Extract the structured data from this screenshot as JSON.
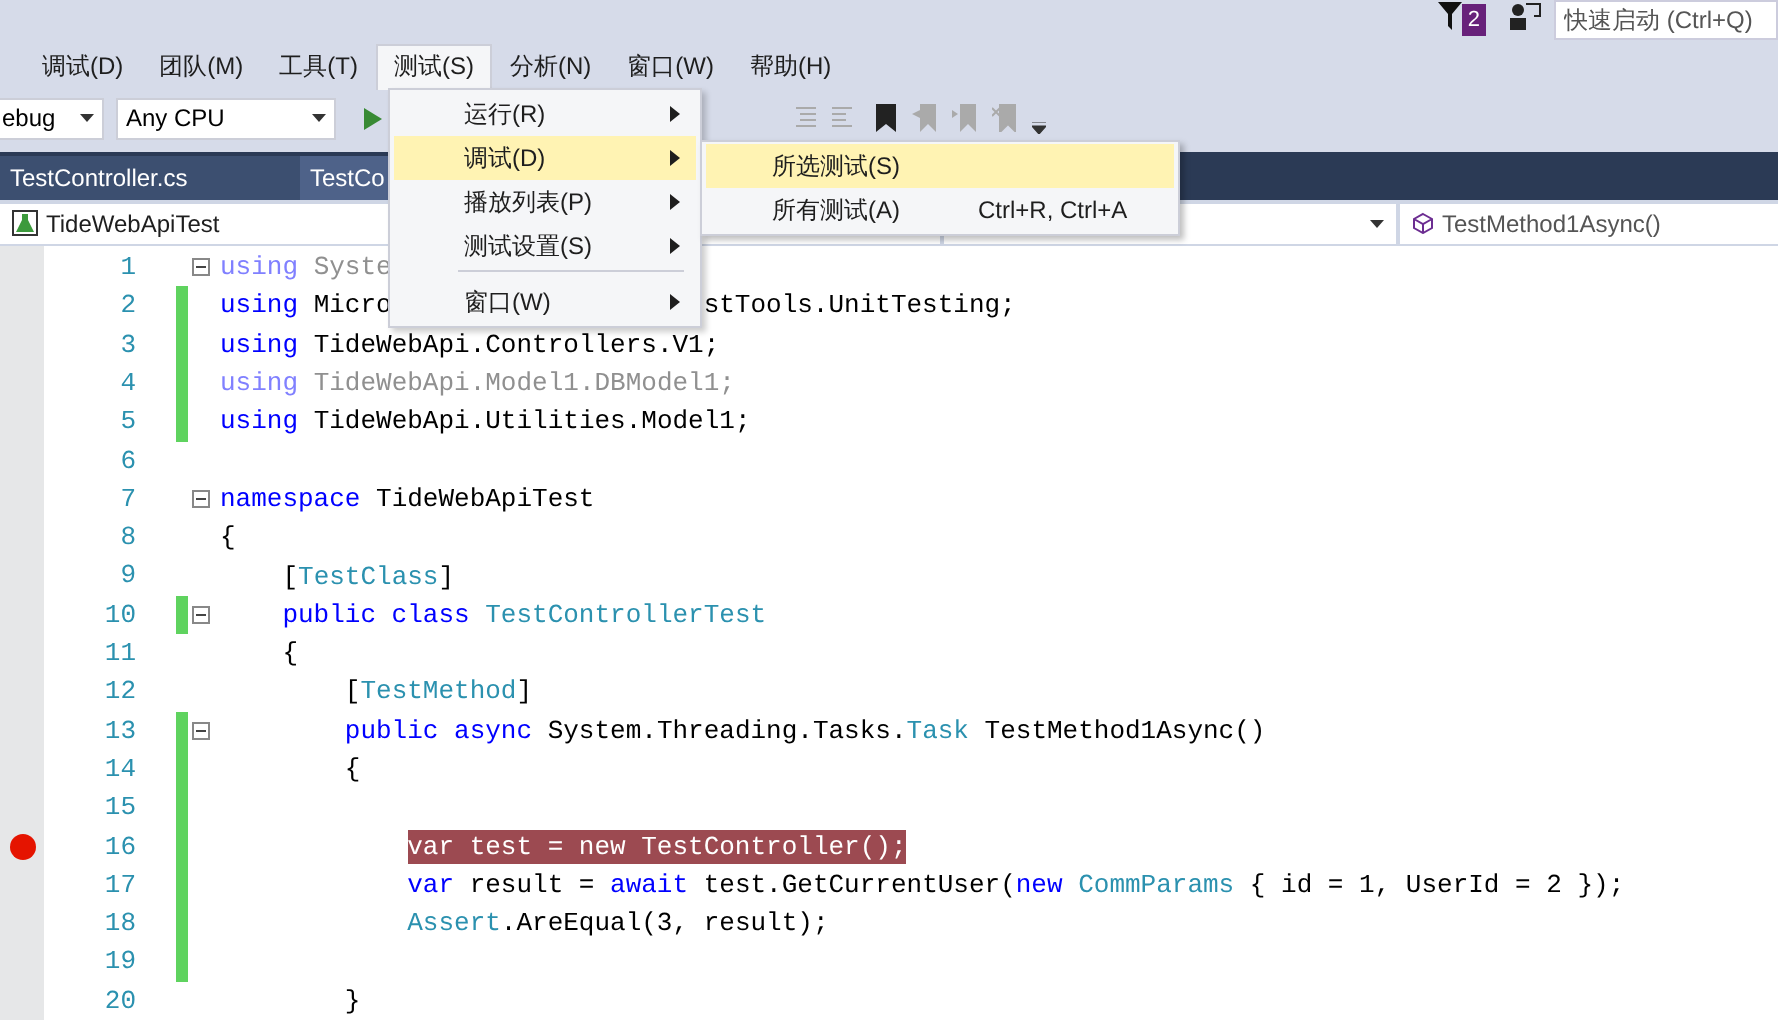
{
  "title_bar": {
    "notification_count": "2",
    "quick_launch": {
      "placeholder": "快速启动 (Ctrl+Q)"
    }
  },
  "menu_bar": [
    {
      "label": "调试(D)",
      "selected": false
    },
    {
      "label": "团队(M)",
      "selected": false
    },
    {
      "label": "工具(T)",
      "selected": false
    },
    {
      "label": "测试(S)",
      "selected": true
    },
    {
      "label": "分析(N)",
      "selected": false
    },
    {
      "label": "窗口(W)",
      "selected": false
    },
    {
      "label": "帮助(H)",
      "selected": false
    }
  ],
  "toolbar": {
    "configuration": "ebug",
    "platform": "Any CPU"
  },
  "tabs": [
    {
      "label": "TestController.cs",
      "selected": true
    },
    {
      "label": "TestCo",
      "selected": false
    }
  ],
  "nav_bar": {
    "project": "TideWebApiTest",
    "member": "TestMethod1Async()"
  },
  "test_menu": [
    {
      "label": "运行(R)",
      "selected": false,
      "submenu": true
    },
    {
      "label": "调试(D)",
      "selected": true,
      "submenu": true
    },
    {
      "label": "播放列表(P)",
      "selected": false,
      "submenu": true
    },
    {
      "label": "测试设置(S)",
      "selected": false,
      "submenu": true
    },
    {
      "kind": "separator"
    },
    {
      "label": "窗口(W)",
      "selected": false,
      "submenu": true
    }
  ],
  "debug_submenu": [
    {
      "label": "所选测试(S)",
      "selected": true
    },
    {
      "label": "所有测试(A)",
      "shortcut": "Ctrl+R, Ctrl+A",
      "selected": false
    }
  ],
  "code": [
    {
      "number": "1",
      "faded": true,
      "changed": false,
      "fold": true,
      "breakpoint": false,
      "tokens": [
        {
          "text": "using",
          "kind": "keyword"
        },
        {
          "text": " Syste",
          "kind": "plain"
        }
      ]
    },
    {
      "number": "2",
      "faded": false,
      "changed": true,
      "fold": false,
      "breakpoint": false,
      "tokens": [
        {
          "text": "using",
          "kind": "keyword"
        },
        {
          "text": " Micro",
          "kind": "plain"
        }
      ],
      "tail": "stTools.UnitTesting;"
    },
    {
      "number": "3",
      "faded": false,
      "changed": true,
      "fold": false,
      "breakpoint": false,
      "tokens": [
        {
          "text": "using",
          "kind": "keyword"
        },
        {
          "text": " TideWebApi.Controllers.V1;",
          "kind": "plain"
        }
      ]
    },
    {
      "number": "4",
      "faded": true,
      "changed": true,
      "fold": false,
      "breakpoint": false,
      "tokens": [
        {
          "text": "using",
          "kind": "keyword"
        },
        {
          "text": " TideWebApi.Model1.DBModel1;",
          "kind": "plain"
        }
      ]
    },
    {
      "number": "5",
      "faded": false,
      "changed": true,
      "fold": false,
      "breakpoint": false,
      "tokens": [
        {
          "text": "using",
          "kind": "keyword"
        },
        {
          "text": " TideWebApi.Utilities.Model1;",
          "kind": "plain"
        }
      ]
    },
    {
      "number": "6",
      "changed": false,
      "fold": false,
      "breakpoint": false
    },
    {
      "number": "7",
      "faded": false,
      "changed": false,
      "fold": true,
      "breakpoint": false,
      "tokens": [
        {
          "text": "namespace",
          "kind": "keyword"
        },
        {
          "text": " TideWebApiTest",
          "kind": "plain"
        }
      ]
    },
    {
      "number": "8",
      "faded": false,
      "changed": false,
      "fold": false,
      "breakpoint": false,
      "tokens": [
        {
          "text": "{",
          "kind": "plain"
        }
      ],
      "children": [
        {
          "number": "9",
          "faded": false,
          "changed": false,
          "fold": false,
          "breakpoint": false,
          "tokens": [
            {
              "text": "[",
              "kind": "plain"
            },
            {
              "text": "TestClass",
              "kind": "type"
            },
            {
              "text": "]",
              "kind": "plain"
            }
          ]
        },
        {
          "number": "10",
          "faded": false,
          "changed": true,
          "fold": true,
          "breakpoint": false,
          "tokens": [
            {
              "text": "public class ",
              "kind": "keyword"
            },
            {
              "text": "TestControllerTest",
              "kind": "type"
            }
          ]
        },
        {
          "number": "11",
          "faded": false,
          "changed": false,
          "fold": false,
          "breakpoint": false,
          "tokens": [
            {
              "text": "{",
              "kind": "plain"
            }
          ],
          "children": [
            {
              "number": "12",
              "faded": false,
              "changed": false,
              "fold": false,
              "breakpoint": false,
              "tokens": [
                {
                  "text": "[",
                  "kind": "plain"
                },
                {
                  "text": "TestMethod",
                  "kind": "type"
                },
                {
                  "text": "]",
                  "kind": "plain"
                }
              ]
            },
            {
              "number": "13",
              "faded": false,
              "changed": true,
              "fold": true,
              "breakpoint": false,
              "tokens": [
                {
                  "text": "public async",
                  "kind": "keyword"
                },
                {
                  "text": " System.Threading.Tasks.",
                  "kind": "plain"
                },
                {
                  "text": "Task",
                  "kind": "type"
                },
                {
                  "text": " TestMethod1Async()",
                  "kind": "plain"
                }
              ]
            },
            {
              "number": "14",
              "faded": false,
              "changed": true,
              "fold": false,
              "breakpoint": false,
              "tokens": [
                {
                  "text": "{",
                  "kind": "plain"
                }
              ],
              "children": [
                {
                  "number": "15",
                  "changed": true,
                  "fold": false,
                  "breakpoint": false
                },
                {
                  "number": "16",
                  "faded": false,
                  "changed": true,
                  "fold": false,
                  "breakpoint": true,
                  "tokens": [
                    {
                      "text": "var test = new TestController();",
                      "kind": "plain"
                    }
                  ]
                },
                {
                  "number": "17",
                  "faded": false,
                  "changed": true,
                  "fold": false,
                  "breakpoint": false,
                  "tokens": [
                    {
                      "text": "var",
                      "kind": "keyword"
                    },
                    {
                      "text": " result = ",
                      "kind": "plain"
                    },
                    {
                      "text": "await",
                      "kind": "keyword"
                    },
                    {
                      "text": " test.GetCurrentUser(",
                      "kind": "plain"
                    },
                    {
                      "text": "new ",
                      "kind": "keyword"
                    },
                    {
                      "text": "CommParams",
                      "kind": "type"
                    },
                    {
                      "text": " { id = 1, UserId = 2 });",
                      "kind": "plain"
                    }
                  ]
                },
                {
                  "number": "18",
                  "faded": false,
                  "changed": true,
                  "fold": false,
                  "breakpoint": false,
                  "tokens": [
                    {
                      "text": "Assert",
                      "kind": "type"
                    },
                    {
                      "text": ".AreEqual(3, result);",
                      "kind": "plain"
                    }
                  ]
                },
                {
                  "number": "19",
                  "changed": true,
                  "fold": false,
                  "breakpoint": false
                }
              ]
            },
            {
              "number": "20",
              "faded": false,
              "changed": false,
              "fold": false,
              "breakpoint": false,
              "tokens": [
                {
                  "text": "}",
                  "kind": "plain"
                }
              ]
            }
          ]
        }
      ]
    }
  ]
}
